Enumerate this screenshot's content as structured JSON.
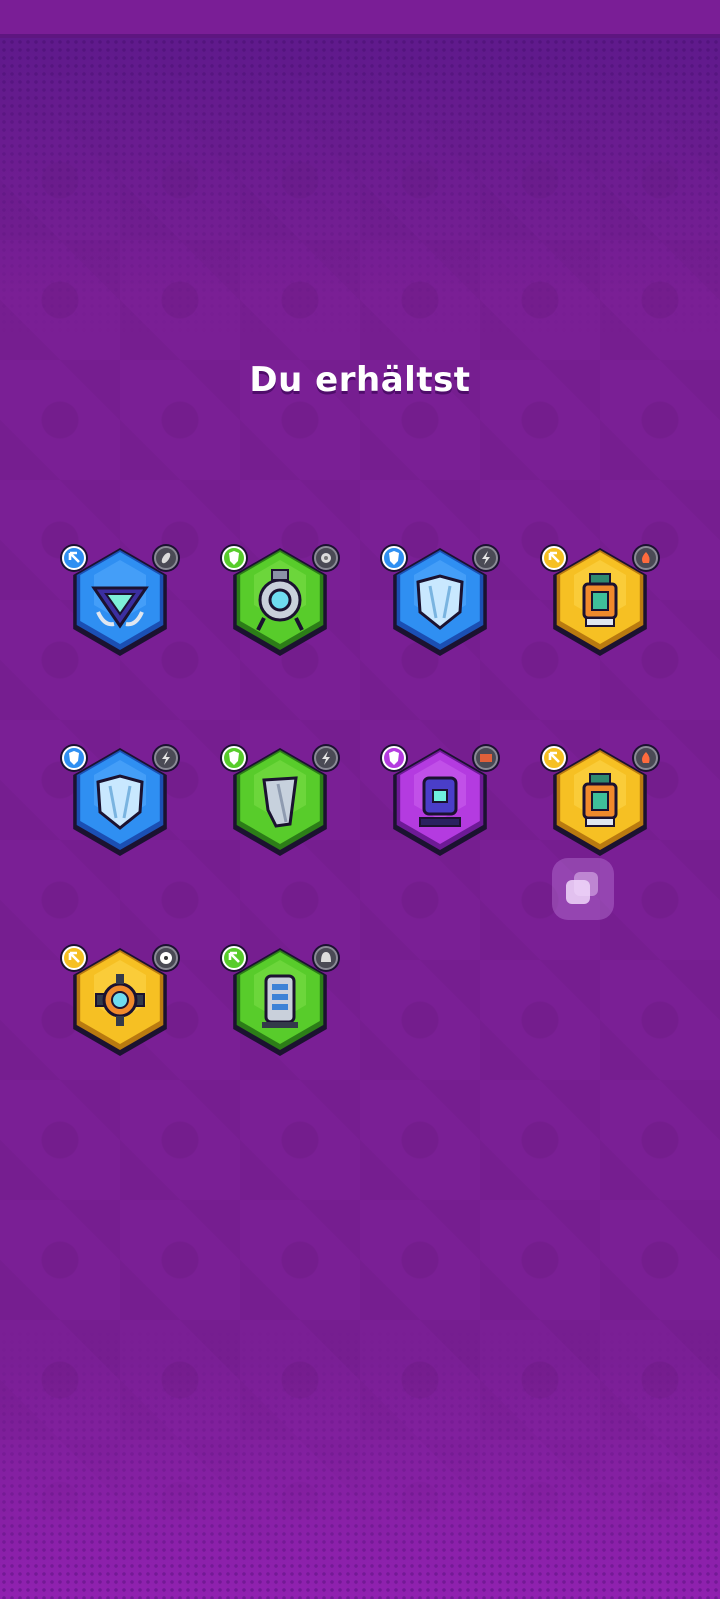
{
  "screen": {
    "title": "Du erhältst"
  },
  "rewards": [
    {
      "color": "blue",
      "main_icon": "triangle-drone-icon",
      "rarity_icon": "arrow-rarity-icon",
      "tag_icon": "grenade-tag-icon"
    },
    {
      "color": "green",
      "main_icon": "ring-turret-icon",
      "rarity_icon": "shield-rarity-icon",
      "tag_icon": "gear-tag-icon"
    },
    {
      "color": "blue",
      "main_icon": "shield-armor-icon",
      "rarity_icon": "shield-rarity-icon",
      "tag_icon": "bolt-tag-icon"
    },
    {
      "color": "yellow",
      "main_icon": "spray-canister-icon",
      "rarity_icon": "arrow-rarity-icon",
      "tag_icon": "fire-tag-icon"
    },
    {
      "color": "blue",
      "main_icon": "shield-armor-icon",
      "rarity_icon": "shield-rarity-icon",
      "tag_icon": "bolt-tag-icon"
    },
    {
      "color": "green",
      "main_icon": "shard-shield-icon",
      "rarity_icon": "shield-rarity-icon",
      "tag_icon": "bolt-tag-icon"
    },
    {
      "color": "purple",
      "main_icon": "robot-head-icon",
      "rarity_icon": "shield-rarity-icon",
      "tag_icon": "brick-tag-icon"
    },
    {
      "color": "yellow",
      "main_icon": "spray-canister-icon",
      "rarity_icon": "arrow-rarity-icon",
      "tag_icon": "fire-tag-icon"
    },
    {
      "color": "yellow",
      "main_icon": "scope-crosshair-icon",
      "rarity_icon": "arrow-rarity-icon",
      "tag_icon": "ball-tag-icon"
    },
    {
      "color": "green",
      "main_icon": "battery-pillar-icon",
      "rarity_icon": "arrow-rarity-icon",
      "tag_icon": "bell-tag-icon"
    }
  ],
  "palette": {
    "blue": {
      "fill": "#2f8ff2",
      "light": "#5fb1ff",
      "dark": "#1b4fb3"
    },
    "green": {
      "fill": "#58cc2b",
      "light": "#86e24f",
      "dark": "#2c7d18"
    },
    "yellow": {
      "fill": "#f6c023",
      "light": "#ffdc55",
      "dark": "#b97a10"
    },
    "purple": {
      "fill": "#b43be0",
      "light": "#d06af2",
      "dark": "#6d1a96"
    },
    "outline": "#1b1230",
    "background": "#7a1f95"
  },
  "overlay": {
    "icon": "copy-stack-icon"
  }
}
